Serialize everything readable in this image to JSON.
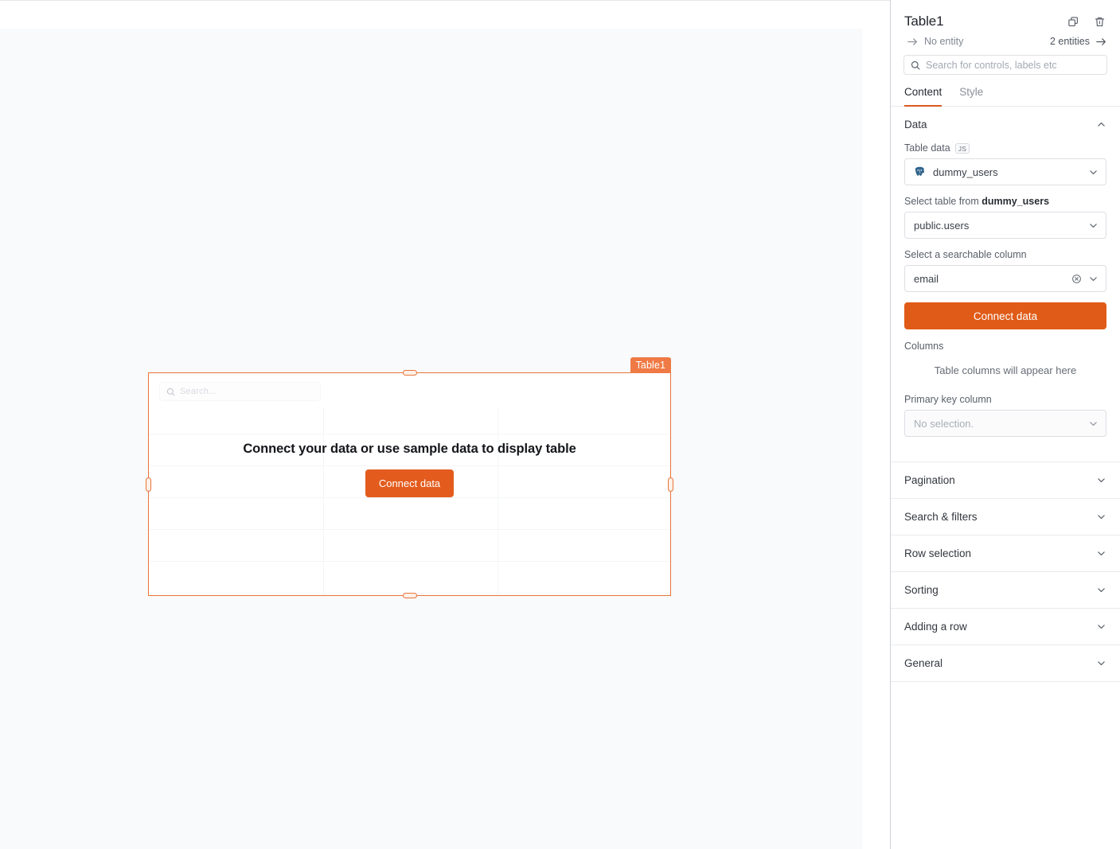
{
  "panel": {
    "title": "Table1",
    "actions": [
      {
        "name": "duplicate-button",
        "label": "Duplicate"
      },
      {
        "name": "delete-button",
        "label": "Delete"
      }
    ],
    "entity": {
      "no_entity_label": "No entity",
      "entities_count_label": "2 entities"
    },
    "search": {
      "placeholder": "Search for controls, labels etc",
      "value": ""
    },
    "tabs": [
      {
        "label": "Content",
        "active": true
      },
      {
        "label": "Style",
        "active": false
      }
    ],
    "sections": [
      {
        "label": "Data",
        "expanded": true
      },
      {
        "label": "Pagination",
        "expanded": false
      },
      {
        "label": "Search & filters",
        "expanded": false
      },
      {
        "label": "Row selection",
        "expanded": false
      },
      {
        "label": "Sorting",
        "expanded": false
      },
      {
        "label": "Adding a row",
        "expanded": false
      },
      {
        "label": "General",
        "expanded": false
      }
    ],
    "data_section": {
      "table_data_label": "Table data",
      "js_badge": "JS",
      "datasource_value": "dummy_users",
      "datasource_icon": "postgresql-icon",
      "select_table_label_prefix": "Select table from ",
      "select_table_label_source": "dummy_users",
      "table_value": "public.users",
      "searchable_column_label": "Select a searchable column",
      "searchable_column_value": "email",
      "connect_data_label": "Connect data",
      "columns_label": "Columns",
      "columns_empty_text": "Table columns will appear here",
      "primary_key_label": "Primary key column",
      "primary_key_value": "No selection."
    }
  },
  "canvas": {
    "widget": {
      "name_badge": "Table1",
      "search_placeholder": "Search...",
      "empty_title": "Connect your data or use sample data to display table",
      "connect_button_label": "Connect data",
      "grid": {
        "row_line_offsets": [
          33,
          73,
          113,
          153,
          193,
          233
        ],
        "col_line_offsets": [
          219,
          438
        ]
      }
    }
  },
  "colors": {
    "accent_orange": "#e05b17",
    "widget_border": "#e8753a",
    "badge_orange": "#ef7a45",
    "canvas_bg": "#f9fafb",
    "panel_border": "#cdd0d6"
  }
}
